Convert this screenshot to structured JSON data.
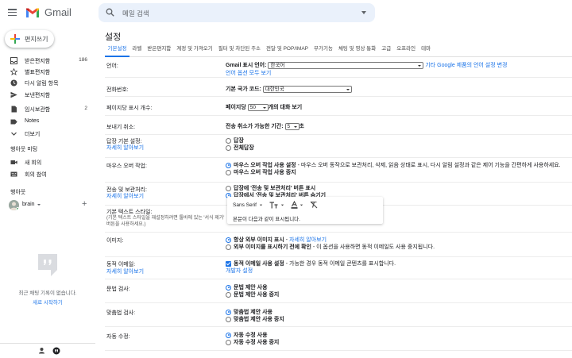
{
  "app": {
    "name": "Gmail"
  },
  "search": {
    "placeholder": "메일 검색"
  },
  "compose": {
    "label": "편지쓰기"
  },
  "sidebar": {
    "items": [
      {
        "label": "받은편지함",
        "count": "186",
        "icon": "inbox-icon"
      },
      {
        "label": "별표편지함",
        "count": "",
        "icon": "star-icon"
      },
      {
        "label": "다시 알림 항목",
        "count": "",
        "icon": "clock-icon"
      },
      {
        "label": "보낸편지함",
        "count": "",
        "icon": "send-icon"
      },
      {
        "label": "임시보관함",
        "count": "2",
        "icon": "draft-icon"
      },
      {
        "label": "Notes",
        "count": "",
        "icon": "label-icon"
      },
      {
        "label": "더보기",
        "count": "",
        "icon": "chevron-down-icon"
      }
    ],
    "meet": {
      "title": "행아웃 미팅",
      "items": [
        {
          "label": "새 회의",
          "icon": "video-icon"
        },
        {
          "label": "회의 참여",
          "icon": "keyboard-icon"
        }
      ]
    },
    "hangouts": {
      "title": "행아웃",
      "user": "brain"
    },
    "chat_empty": {
      "line1": "최근 채팅 기록이 없습니다.",
      "line2": "새로 시작하기"
    }
  },
  "settings": {
    "title": "설정",
    "tabs": [
      "기본설정",
      "라벨",
      "받은편지함",
      "계정 및 가져오기",
      "필터 및 차단된 주소",
      "전달 및 POP/IMAP",
      "부가기능",
      "채팅 및 영상 통화",
      "고급",
      "오프라인",
      "테마"
    ],
    "active_tab": "기본설정",
    "rows": {
      "language": {
        "label": "언어:",
        "display_label": "Gmail 표시 언어:",
        "value": "한국어",
        "link": "기타 Google 제품의 언어 설정 변경",
        "more": "언어 옵션 모두 보기"
      },
      "phone": {
        "label": "전화번호:",
        "ctl_label": "기본 국가 코드:",
        "value": "대한민국"
      },
      "page_size": {
        "label": "페이지당 표시 개수:",
        "pre": "페이지당",
        "value": "50",
        "post": "개의 대화 보기"
      },
      "undo": {
        "label": "보내기 취소:",
        "pre": "전송 취소가 가능한 기간:",
        "value": "5",
        "post": "초"
      },
      "reply": {
        "label": "답장 기본 설정:",
        "sub": "자세히 알아보기",
        "opt1": "답장",
        "opt2": "전체답장"
      },
      "hover": {
        "label": "마우스 오버 작업:",
        "opt1_b": "마우스 오버 작업 사용 설정",
        "opt1_rest": " - 마우스 오버 동작으로 보관처리, 삭제, 읽음 상태로 표시, 다시 알림 설정과 같은 제어 기능을 간편하게 사용하세요.",
        "opt2": "마우스 오버 작업 사용 중지"
      },
      "send_archive": {
        "label": "전송 및 보관처리:",
        "sub": "자세히 알아보기",
        "opt1": "답장에 '전송 및 보관처리' 버튼 표시",
        "opt2": "답장에서 '전송 및 보관처리' 버튼 숨기기"
      },
      "text_style": {
        "label": "기본 텍스트 스타일:",
        "note": "(기본 텍스트 스타일을 재설정하려면 툴바에 있는 '서식 제거' 버튼을 사용하세요.)",
        "font": "Sans Serif",
        "sample": "본문이 다음과 같이 표시됩니다."
      },
      "images": {
        "label": "이미지:",
        "opt1": "항상 외부 이미지 표시",
        "opt1_link": "자세히 알아보기",
        "opt2_b": "외부 이미지를 표시하기 전에 확인",
        "opt2_rest": " - 이 옵션을 사용하면 동적 이메일도 사용 중지됩니다."
      },
      "dynamic": {
        "label": "동적 이메일:",
        "sub": "자세히 알아보기",
        "opt_b": "동적 이메일 사용 설정",
        "opt_rest": " - 가능한 경우 동적 이메일 콘텐츠를 표시합니다.",
        "dev": "개발자 설정"
      },
      "grammar": {
        "label": "문법 검사:",
        "opt1": "문법 제안 사용",
        "opt2": "문법 제안 사용 중지"
      },
      "spelling": {
        "label": "맞춤법 검사:",
        "opt1": "맞춤법 제안 사용",
        "opt2": "맞춤법 제안 사용 중지"
      },
      "autocorrect": {
        "label": "자동 수정:",
        "opt1": "자동 수정 사용",
        "opt2": "자동 수정 사용 중지"
      }
    }
  },
  "colors": {
    "accent": "#1a73e8",
    "search_bg": "#eaf1fb"
  }
}
